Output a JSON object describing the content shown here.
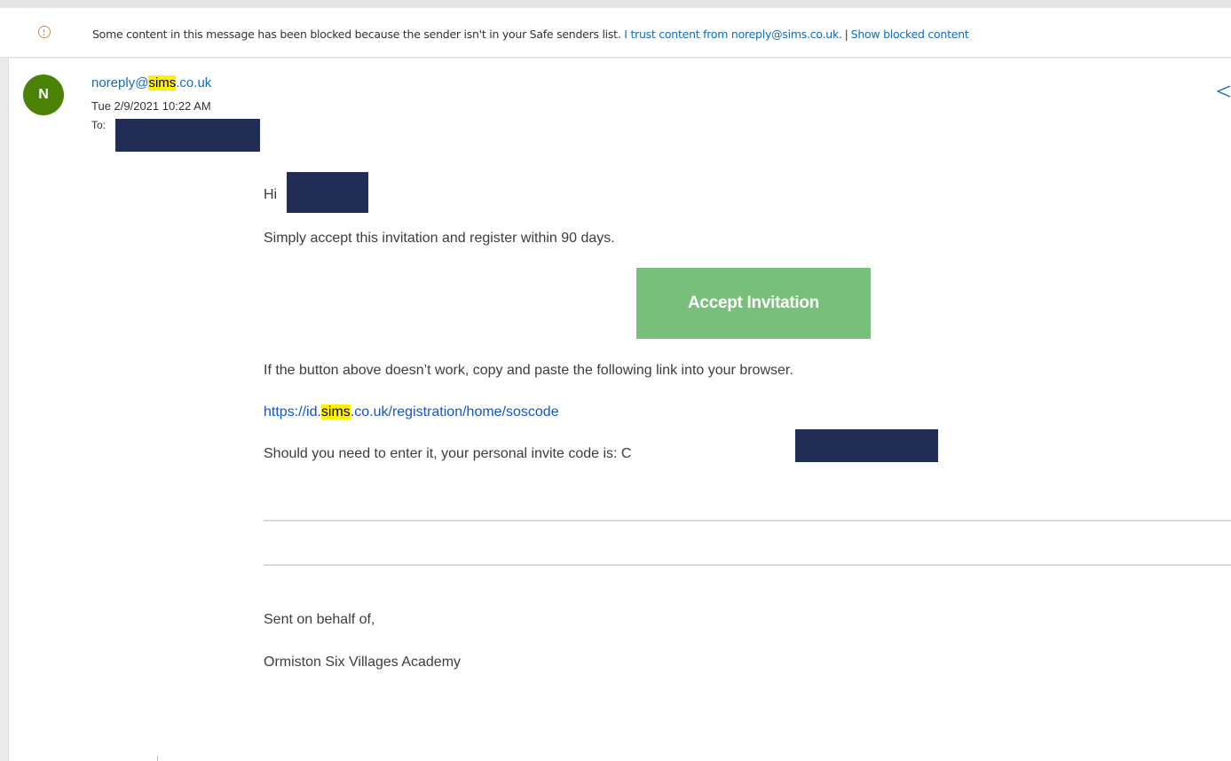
{
  "banner": {
    "message": "Some content in this message has been blocked because the sender isn't in your Safe senders list.",
    "trust_link": "I trust content from noreply@sims.co.uk.",
    "separator": "|",
    "show_blocked_link": "Show blocked content"
  },
  "header": {
    "avatar_initial": "N",
    "sender_prefix": "noreply@",
    "sender_highlight": "sims",
    "sender_suffix": ".co.uk",
    "date": "Tue 2/9/2021 10:22 AM",
    "to_label": "To:"
  },
  "body": {
    "greeting": "Hi",
    "intro": "Simply accept this invitation and register within 90 days.",
    "accept_button": "Accept Invitation",
    "fallback": "If the button above doesn’t work, copy and paste the following link into your browser.",
    "link_prefix": "https://id.",
    "link_highlight": "sims",
    "link_suffix": ".co.uk/registration/home/soscode",
    "invite_code_text": "Should you need to enter it, your personal invite code is: C",
    "sent_on_behalf": "Sent on behalf of,",
    "organisation": "Ormiston Six Villages Academy"
  },
  "colors": {
    "link": "#0f6cbd",
    "highlight": "#fff100",
    "avatar": "#498205",
    "button": "#77bf7b",
    "redaction": "#222d55",
    "warning_icon": "#e0874e"
  }
}
